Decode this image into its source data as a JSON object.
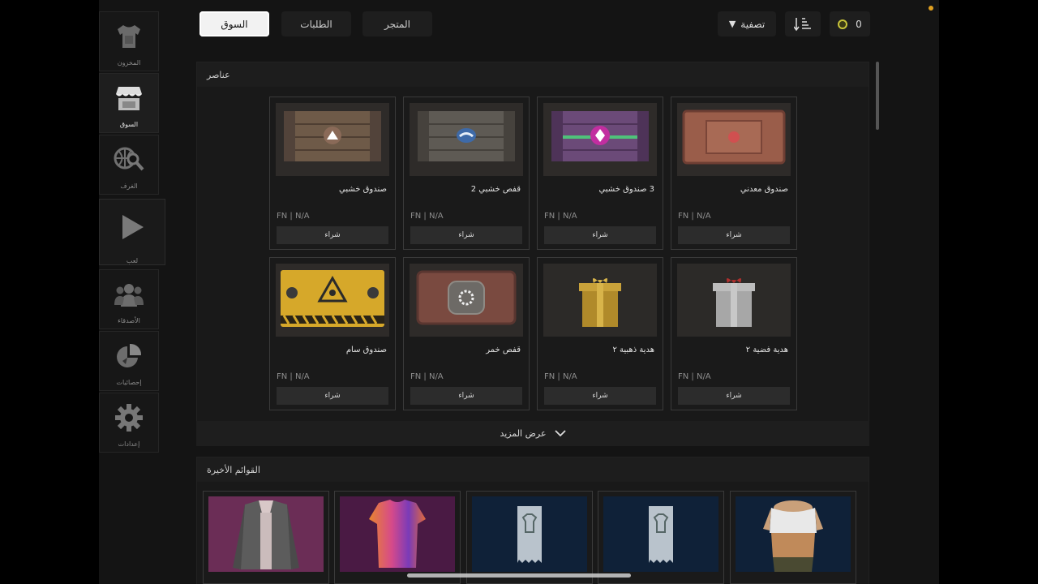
{
  "sidebar": {
    "items": [
      {
        "label": "المخزون",
        "icon": "shirt-icon"
      },
      {
        "label": "السوق",
        "icon": "shop-icon",
        "active": true
      },
      {
        "label": "الغرف",
        "icon": "globe-search-icon"
      },
      {
        "label": "لعب",
        "icon": "play-icon"
      },
      {
        "label": "الأصدقاء",
        "icon": "friends-icon"
      },
      {
        "label": "إحصائيات",
        "icon": "pie-chart-icon"
      },
      {
        "label": "إعدادات",
        "icon": "gear-icon"
      }
    ]
  },
  "tabs": [
    {
      "label": "السوق",
      "active": true
    },
    {
      "label": "الطلبات"
    },
    {
      "label": "المتجر"
    }
  ],
  "toolbar": {
    "filter_label": "تصفية",
    "balance": "0"
  },
  "items_section": {
    "title": "عناصر",
    "show_more_label": "عرض المزيد",
    "cards": [
      {
        "name": "صندوق معدني",
        "meta": "FN | N/A",
        "buy": "شراء",
        "art": "metal"
      },
      {
        "name": "3 صندوق خشبي",
        "meta": "FN | N/A",
        "buy": "شراء",
        "art": "purple"
      },
      {
        "name": "قفص خشبي 2",
        "meta": "FN | N/A",
        "buy": "شراء",
        "art": "blue"
      },
      {
        "name": "صندوق خشبي",
        "meta": "FN | N/A",
        "buy": "شراء",
        "art": "wood"
      },
      {
        "name": "هدية فضية ٢",
        "meta": "FN | N/A",
        "buy": "شراء",
        "art": "silver"
      },
      {
        "name": "هدية ذهبية ٢",
        "meta": "FN | N/A",
        "buy": "شراء",
        "art": "gold"
      },
      {
        "name": "قفص خمر",
        "meta": "FN | N/A",
        "buy": "شراء",
        "art": "rust"
      },
      {
        "name": "صندوق سام",
        "meta": "FN | N/A",
        "buy": "شراء",
        "art": "toxic"
      }
    ]
  },
  "recent_section": {
    "title": "القوائم الأخيرة"
  },
  "colors": {
    "background": "#141414",
    "card_border": "#3a3a3a",
    "active_tab": "#f2f2f2",
    "coin": "#c8c43a"
  }
}
